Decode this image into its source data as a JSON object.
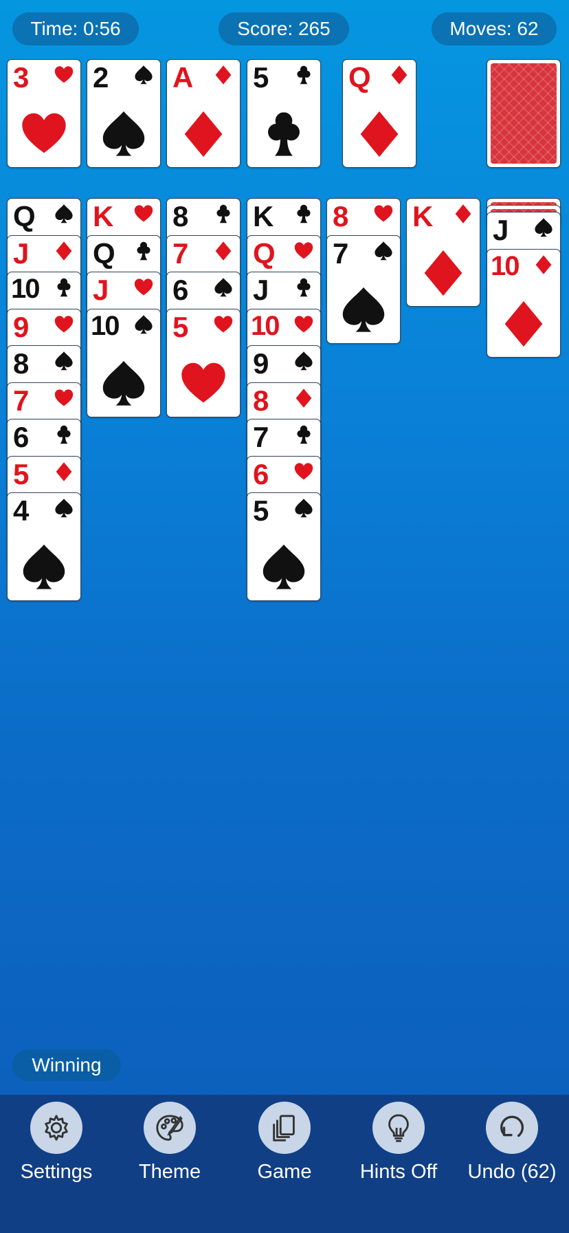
{
  "header": {
    "time": "Time: 0:56",
    "score": "Score: 265",
    "moves": "Moves: 62"
  },
  "foundations": [
    {
      "rank": "3",
      "suit": "hearts"
    },
    {
      "rank": "2",
      "suit": "spades"
    },
    {
      "rank": "A",
      "suit": "diamonds"
    },
    {
      "rank": "5",
      "suit": "clubs"
    }
  ],
  "waste": {
    "rank": "Q",
    "suit": "diamonds"
  },
  "stock": {
    "face_down": true
  },
  "tableau": [
    {
      "hidden": 0,
      "cards": [
        {
          "rank": "Q",
          "suit": "spades"
        },
        {
          "rank": "J",
          "suit": "diamonds"
        },
        {
          "rank": "10",
          "suit": "clubs"
        },
        {
          "rank": "9",
          "suit": "hearts"
        },
        {
          "rank": "8",
          "suit": "spades"
        },
        {
          "rank": "7",
          "suit": "hearts"
        },
        {
          "rank": "6",
          "suit": "clubs"
        },
        {
          "rank": "5",
          "suit": "diamonds"
        },
        {
          "rank": "4",
          "suit": "spades"
        }
      ]
    },
    {
      "hidden": 0,
      "cards": [
        {
          "rank": "K",
          "suit": "hearts"
        },
        {
          "rank": "Q",
          "suit": "clubs"
        },
        {
          "rank": "J",
          "suit": "hearts"
        },
        {
          "rank": "10",
          "suit": "spades"
        }
      ]
    },
    {
      "hidden": 0,
      "cards": [
        {
          "rank": "8",
          "suit": "clubs"
        },
        {
          "rank": "7",
          "suit": "diamonds"
        },
        {
          "rank": "6",
          "suit": "spades"
        },
        {
          "rank": "5",
          "suit": "hearts"
        }
      ]
    },
    {
      "hidden": 0,
      "cards": [
        {
          "rank": "K",
          "suit": "clubs"
        },
        {
          "rank": "Q",
          "suit": "hearts"
        },
        {
          "rank": "J",
          "suit": "clubs"
        },
        {
          "rank": "10",
          "suit": "hearts"
        },
        {
          "rank": "9",
          "suit": "spades"
        },
        {
          "rank": "8",
          "suit": "diamonds"
        },
        {
          "rank": "7",
          "suit": "clubs"
        },
        {
          "rank": "6",
          "suit": "hearts"
        },
        {
          "rank": "5",
          "suit": "spades"
        }
      ]
    },
    {
      "hidden": 0,
      "cards": [
        {
          "rank": "8",
          "suit": "hearts"
        },
        {
          "rank": "7",
          "suit": "spades"
        }
      ]
    },
    {
      "hidden": 0,
      "cards": [
        {
          "rank": "K",
          "suit": "diamonds"
        }
      ]
    },
    {
      "hidden": 2,
      "cards": [
        {
          "rank": "J",
          "suit": "spades"
        },
        {
          "rank": "10",
          "suit": "diamonds"
        }
      ]
    }
  ],
  "status": "Winning",
  "toolbar": [
    {
      "id": "settings",
      "label": "Settings",
      "icon": "gear-icon"
    },
    {
      "id": "theme",
      "label": "Theme",
      "icon": "palette-icon"
    },
    {
      "id": "game",
      "label": "Game",
      "icon": "cards-icon"
    },
    {
      "id": "hints",
      "label": "Hints Off",
      "icon": "lightbulb-icon"
    },
    {
      "id": "undo",
      "label": "Undo (62)",
      "icon": "undo-icon"
    }
  ],
  "colors": {
    "red_suit": "#e0141e",
    "black_suit": "#111111",
    "toolbar_bg": "#103f86",
    "pill_bg": "#0b72b3",
    "card_back": "#d8343c"
  }
}
